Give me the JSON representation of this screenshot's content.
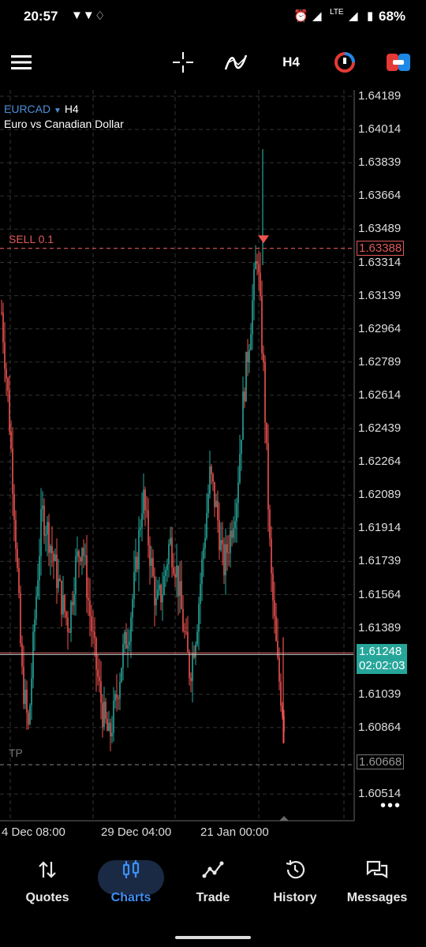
{
  "status_bar": {
    "time": "20:57",
    "network": "LTE",
    "battery": "68%"
  },
  "toolbar": {
    "timeframe": "H4"
  },
  "chart_header": {
    "symbol": "EURCAD",
    "timeframe": "H4",
    "description": "Euro vs Canadian Dollar"
  },
  "orders": {
    "sell_label": "SELL 0.1",
    "sell_price": "1.63388",
    "tp_label": "TP",
    "tp_price": "1.60668"
  },
  "current": {
    "price": "1.61248",
    "countdown": "02:02:03"
  },
  "colors": {
    "bull": "#26a69a",
    "bear": "#ef5350",
    "sell_line": "#e05a5a",
    "accent": "#3d8ff5"
  },
  "chart_data": {
    "type": "candlestick",
    "symbol": "EURCAD",
    "timeframe": "H4",
    "y_ticks": [
      "1.64189",
      "1.64014",
      "1.63839",
      "1.63664",
      "1.63489",
      "1.63314",
      "1.63139",
      "1.62964",
      "1.62789",
      "1.62614",
      "1.62439",
      "1.62264",
      "1.62089",
      "1.61914",
      "1.61739",
      "1.61564",
      "1.61389",
      "1.61039",
      "1.60864",
      "1.60514"
    ],
    "x_ticks": [
      "4 Dec 08:00",
      "29 Dec 04:00",
      "21 Jan 00:00"
    ],
    "ylim": [
      1.6047,
      1.643
    ],
    "horizontal_lines": [
      {
        "name": "SELL 0.1",
        "value": 1.63388,
        "style": "dashed"
      },
      {
        "name": "bid",
        "value": 1.61248,
        "style": "solid"
      },
      {
        "name": "TP",
        "value": 1.60668,
        "style": "dashed"
      }
    ],
    "close_path": [
      1.6305,
      1.6258,
      1.6195,
      1.6115,
      1.6085,
      1.6148,
      1.62,
      1.6188,
      1.617,
      1.6152,
      1.614,
      1.6172,
      1.6185,
      1.615,
      1.612,
      1.6095,
      1.608,
      1.61,
      1.6125,
      1.614,
      1.617,
      1.621,
      1.618,
      1.615,
      1.616,
      1.6185,
      1.617,
      1.614,
      1.6115,
      1.614,
      1.618,
      1.622,
      1.62,
      1.617,
      1.6188,
      1.621,
      1.6262,
      1.6298,
      1.6338,
      1.627,
      1.617,
      1.612,
      1.609
    ],
    "grid": true
  },
  "bottom_nav": [
    {
      "label": "Quotes"
    },
    {
      "label": "Charts"
    },
    {
      "label": "Trade"
    },
    {
      "label": "History"
    },
    {
      "label": "Messages"
    }
  ]
}
